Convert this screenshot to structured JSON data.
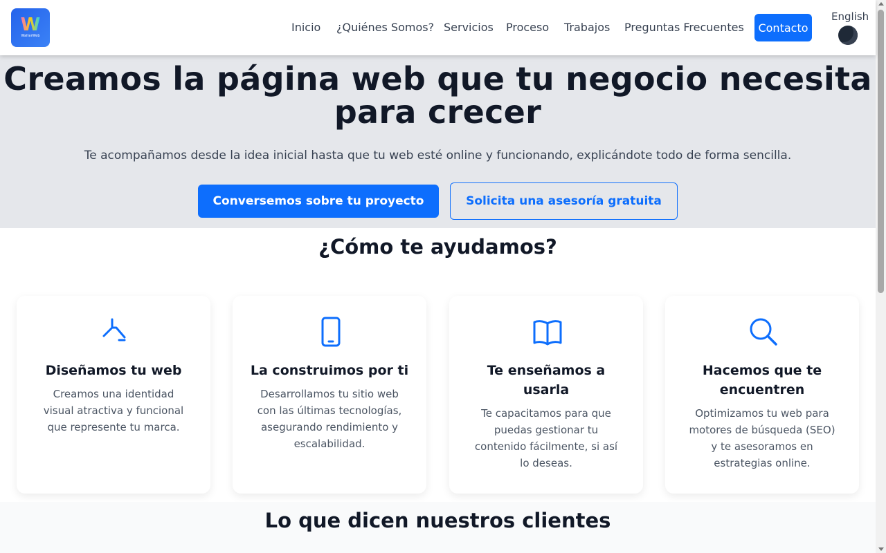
{
  "header": {
    "logo_letter": "W",
    "logo_text": "WalterWeb",
    "nav": [
      "Inicio",
      "¿Quiénes Somos?",
      "Servicios",
      "Proceso",
      "Trabajos",
      "Preguntas Frecuentes"
    ],
    "contact_label": "Contacto",
    "language_label": "English"
  },
  "hero": {
    "title_line1": "Creamos la página web que tu negocio necesita",
    "title_line2": "para crecer",
    "subtitle": "Te acompañamos desde la idea inicial hasta que tu web esté online y funcionando, explicándote todo de forma sencilla.",
    "primary_cta": "Conversemos sobre tu proyecto",
    "secondary_cta": "Solicita una asesoría gratuita"
  },
  "services": {
    "title": "¿Cómo te ayudamos?",
    "cards": [
      {
        "icon": "design-tool-icon",
        "title": "Diseñamos tu web",
        "description": "Creamos una identidad visual atractiva y funcional que represente tu marca."
      },
      {
        "icon": "smartphone-icon",
        "title": "La construimos por ti",
        "description": "Desarrollamos tu sitio web con las últimas tecnologías, asegurando rendimiento y escalabilidad."
      },
      {
        "icon": "book-icon",
        "title": "Te enseñamos a usarla",
        "description": "Te capacitamos para que puedas gestionar tu contenido fácilmente, si así lo deseas."
      },
      {
        "icon": "search-icon",
        "title": "Hacemos que te encuentren",
        "description": "Optimizamos tu web para motores de búsqueda (SEO) y te asesoramos en estrategias online."
      }
    ]
  },
  "testimonials": {
    "title": "Lo que dicen nuestros clientes"
  },
  "colors": {
    "accent": "#0d6efd",
    "hero_bg": "#e5e7eb",
    "text_dark": "#111827"
  }
}
